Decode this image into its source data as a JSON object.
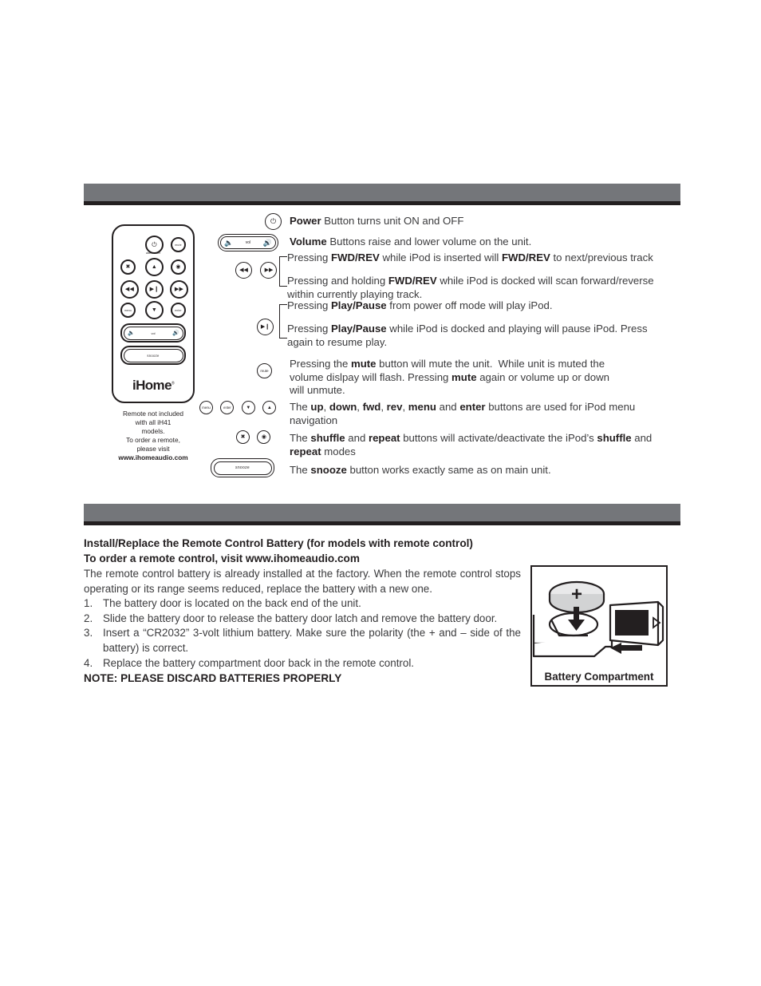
{
  "document": {
    "sections": [
      {
        "id": "remote-control",
        "bar_color": "#74767a"
      },
      {
        "id": "battery",
        "bar_color": "#74767a"
      }
    ]
  },
  "remote_figure": {
    "buttons": {
      "power": "power-icon",
      "power_sublabel": "alarm reset",
      "mute": "mute",
      "shuffle": "shuffle-icon",
      "repeat": "repeat-icon",
      "up": "▲",
      "down": "▼",
      "rev": "◀◀",
      "play_pause": "▶‖",
      "fwd": "▶▶",
      "menu": "menu",
      "enter": "enter",
      "vol_down": "🔈",
      "vol_label": "vol",
      "vol_up": "🔊",
      "snooze": "snooze"
    },
    "logo": "iHome",
    "logo_tm": "®",
    "caption_lines": [
      "Remote not included",
      "with all iH41",
      "models.",
      "To order a remote,",
      "please visit"
    ],
    "caption_url": "www.ihomeaudio.com"
  },
  "callouts": [
    {
      "id": "power",
      "icon": "power-icon",
      "text_html": "<b>Power</b> Button turns unit ON and OFF"
    },
    {
      "id": "volume",
      "icon": "volume-pill",
      "vol_label": "vol",
      "text_html": "<b>Volume</b> Buttons raise and lower volume on the unit."
    },
    {
      "id": "fwd-rev",
      "icons": [
        "rev-icon",
        "fwd-icon"
      ],
      "line1_html": "Pressing <b>FWD/REV</b> while iPod is inserted will <b>FWD/REV</b> to next/previous track",
      "line2_html": "Pressing and holding <b>FWD/REV</b> while iPod is docked will scan forward/reverse within currently playing track."
    },
    {
      "id": "play-pause",
      "icon": "play-pause-icon",
      "line1_html": "Pressing <b>Play/Pause</b> from power off mode will play iPod.",
      "line2_html": "Pressing <b>Play/Pause</b> while iPod is docked and playing will pause iPod. Press again to resume play."
    },
    {
      "id": "mute",
      "icon": "mute-icon",
      "icon_label": "mute",
      "text_html": "Pressing the <b>mute</b> button will mute the unit.&nbsp; While unit is muted the volume dislpay will flash. Pressing <b>mute</b> again or volume up or down will unmute."
    },
    {
      "id": "navigation",
      "icons": [
        "menu-icon",
        "enter-icon",
        "down-icon",
        "up-icon"
      ],
      "icon_labels": [
        "menu",
        "enter",
        "▼",
        "▲"
      ],
      "text_html": "The <b>up</b>, <b>down</b>, <b>fwd</b>, <b>rev</b>, <b>menu</b> and <b>enter</b> buttons are used for iPod menu navigation"
    },
    {
      "id": "shuffle-repeat",
      "icons": [
        "shuffle-icon",
        "repeat-icon"
      ],
      "text_html": "The <b>shuffle</b> and <b>repeat</b> buttons will activate/deactivate the iPod’s <b>shuffle</b> and <b>repeat</b> modes"
    },
    {
      "id": "snooze",
      "icon": "snooze-pill",
      "icon_label": "snooze",
      "text_html": "The <b>snooze</b> button works exactly same as on main unit."
    }
  ],
  "battery": {
    "heading_line1": "Install/Replace the Remote Control Battery (for models with remote control)",
    "heading_line2": "To order a remote control, visit www.ihomeaudio.com",
    "intro": "The remote control battery is already installed at the factory. When the remote control stops operating or its range seems reduced, replace the battery with a new one.",
    "steps": [
      {
        "num": "1.",
        "text": "The battery door is located on the back end of the unit."
      },
      {
        "num": "2.",
        "text": "Slide the battery door to release the battery door latch and remove the battery door."
      },
      {
        "num": "3.",
        "text": "Insert a “CR2032” 3-volt lithium battery. Make sure the polarity (the + and – side of the battery) is correct."
      },
      {
        "num": "4.",
        "text": "Replace the battery compartment door back in the remote control."
      }
    ],
    "note": "NOTE: PLEASE DISCARD BATTERIES PROPERLY",
    "figure_caption": "Battery Compartment",
    "figure_polarity": "+"
  }
}
